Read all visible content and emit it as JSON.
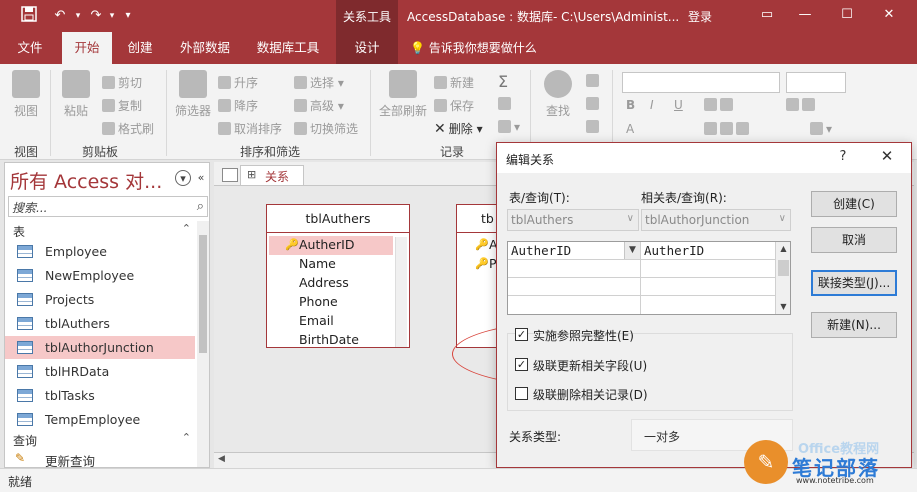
{
  "titlebar": {
    "save_icon": "save-icon",
    "customize_label": "▾",
    "context_group": "关系工具",
    "document_title": "AccessDatabase : 数据库- C:\\Users\\Administ...",
    "login": "登录"
  },
  "ribbon_tabs": [
    {
      "label": "文件"
    },
    {
      "label": "开始"
    },
    {
      "label": "创建"
    },
    {
      "label": "外部数据"
    },
    {
      "label": "数据库工具"
    },
    {
      "label": "设计"
    }
  ],
  "tell_me": "告诉我你想要做什么",
  "ribbon": {
    "views": {
      "view": "视图",
      "group": "视图"
    },
    "clipboard": {
      "paste": "粘贴",
      "cut": "剪切",
      "copy": "复制",
      "format_painter": "格式刷",
      "group": "剪贴板"
    },
    "sort_filter": {
      "filter": "筛选器",
      "ascending": "升序",
      "descending": "降序",
      "remove_sort": "取消排序",
      "selection": "选择",
      "advanced": "高级",
      "toggle_filter": "切换筛选",
      "group": "排序和筛选"
    },
    "records": {
      "refresh_all": "全部刷新",
      "new": "新建",
      "save": "保存",
      "delete": "删除",
      "group": "记录"
    },
    "find": {
      "find": "查找"
    },
    "text_format": {
      "bold": "B",
      "italic": "I",
      "underline": "U",
      "font_color": "A"
    }
  },
  "nav_pane": {
    "title": "所有 Access 对...",
    "search_placeholder": "搜索...",
    "sections": [
      {
        "label": "表",
        "items": [
          "Employee",
          "NewEmployee",
          "Projects",
          "tblAuthers",
          "tblAuthorJunction",
          "tblHRData",
          "tblTasks",
          "TempEmployee"
        ]
      },
      {
        "label": "查询",
        "items": [
          "更新查询"
        ]
      }
    ],
    "selected_item": "tblAuthorJunction"
  },
  "relationships": {
    "tab_label": "关系",
    "table1": {
      "name": "tblAuthers",
      "fields": [
        "AutherID",
        "Name",
        "Address",
        "Phone",
        "Email",
        "BirthDate"
      ]
    },
    "table2": {
      "name": "tb",
      "fields": [
        "A",
        "P"
      ]
    }
  },
  "dialog": {
    "title": "编辑关系",
    "help": "?",
    "close": "✕",
    "table_query_label": "表/查询(T):",
    "related_label": "相关表/查询(R):",
    "table_query_value": "tblAuthers",
    "related_value": "tblAuthorJunction",
    "grid_rows": [
      {
        "left": "AutherID",
        "right": "AutherID"
      }
    ],
    "enforce_label": "实施参照完整性(E)",
    "enforce_checked": true,
    "cascade_update_label": "级联更新相关字段(U)",
    "cascade_update_checked": true,
    "cascade_delete_label": "级联删除相关记录(D)",
    "cascade_delete_checked": false,
    "reltype_label": "关系类型:",
    "reltype_value": "一对多",
    "buttons": {
      "create": "创建(C)",
      "cancel": "取消",
      "join_type": "联接类型(J)...",
      "new": "新建(N)..."
    }
  },
  "status": "就绪",
  "watermark": {
    "top": "Office教程网",
    "main": "笔记部落",
    "url": "www.notetribe.com"
  }
}
